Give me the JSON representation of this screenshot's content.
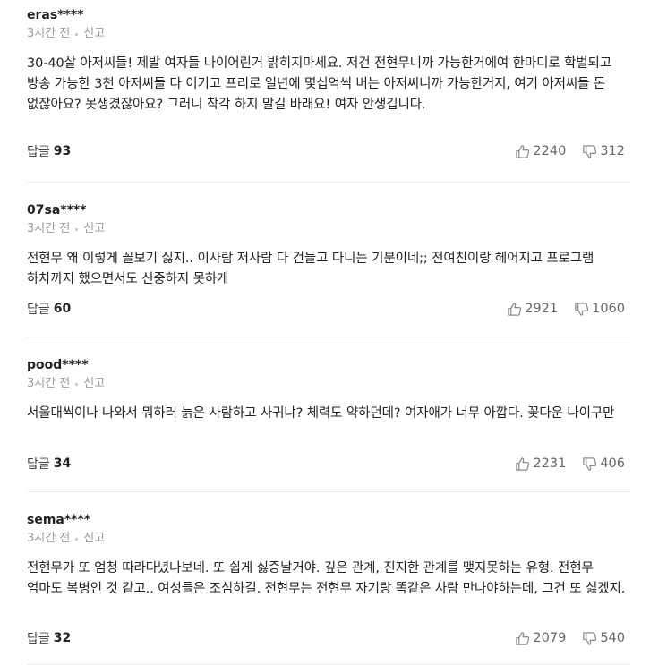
{
  "labels": {
    "report": "신고",
    "reply": "답글"
  },
  "comments": [
    {
      "author": "eras****",
      "time": "3시간 전",
      "text": "30-40살 아저씨들! 제발 여자들 나이어린거 밝히지마세요. 저건 전현무니까 가능한거에여 한마디로 학벌되고 방송 가능한 3천 아저씨들 다 이기고 프리로 일년에 몇십억씩 버는 아저씨니까 가능한거지, 여기 아저씨들 돈 없잖아요? 못생겼잖아요? 그러니 착각 하지 말길 바래요! 여자 안생깁니다.",
      "replies": "93",
      "likes": "2240",
      "dislikes": "312"
    },
    {
      "author": "07sa****",
      "time": "3시간 전",
      "text": "전현무 왜 이렇게 꼴보기 싫지.. 이사람 저사람 다 건들고 다니는 기분이네;; 전여친이랑 헤어지고 프로그램 하차까지 했으면서도 신중하지 못하게",
      "replies": "60",
      "likes": "2921",
      "dislikes": "1060"
    },
    {
      "author": "pood****",
      "time": "3시간 전",
      "text": "서울대씩이나 나와서 뭐하러 늙은 사람하고 사귀냐? 체력도 약하던데? 여자애가 너무 아깝다. 꽃다운 나이구만",
      "replies": "34",
      "likes": "2231",
      "dislikes": "406"
    },
    {
      "author": "sema****",
      "time": "3시간 전",
      "text": "전현무가 또 엄청 따라다녔나보네. 또 쉽게 싫증날거야. 깊은 관계, 진지한 관계를 맺지못하는 유형. 전현무 엄마도 복병인 것 같고.. 여성들은 조심하길. 전현무는 전현무 자기랑 똑같은 사람 만나야하는데, 그건 또 싫겠지.",
      "replies": "32",
      "likes": "2079",
      "dislikes": "540"
    }
  ]
}
